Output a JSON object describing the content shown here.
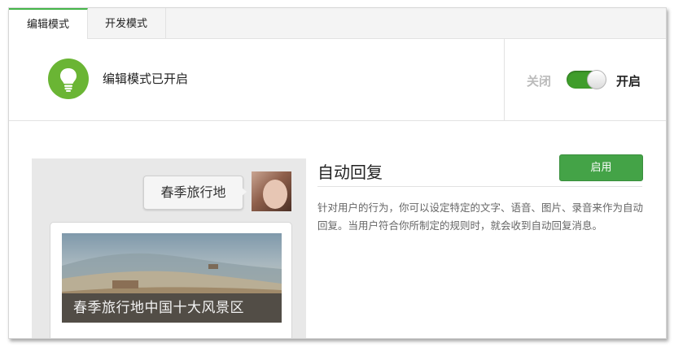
{
  "tabs": [
    {
      "label": "编辑模式",
      "active": true
    },
    {
      "label": "开发模式",
      "active": false
    }
  ],
  "status": {
    "icon": "lightbulb-icon",
    "text": "编辑模式已开启",
    "off_label": "关闭",
    "on_label": "开启",
    "toggle_on": true
  },
  "preview": {
    "message": "春季旅行地",
    "avatar": "user-avatar",
    "news_caption": "春季旅行地中国十大风景区"
  },
  "feature": {
    "title": "自动回复",
    "button_label": "启用",
    "description": "针对用户的行为，你可以设定特定的文字、语音、图片、录音来作为自动回复。当用户符合你所制定的规则时，就会收到自动回复消息。"
  },
  "colors": {
    "accent_green": "#44b549",
    "button_green": "#44a347",
    "bulb_green": "#6ab534"
  }
}
